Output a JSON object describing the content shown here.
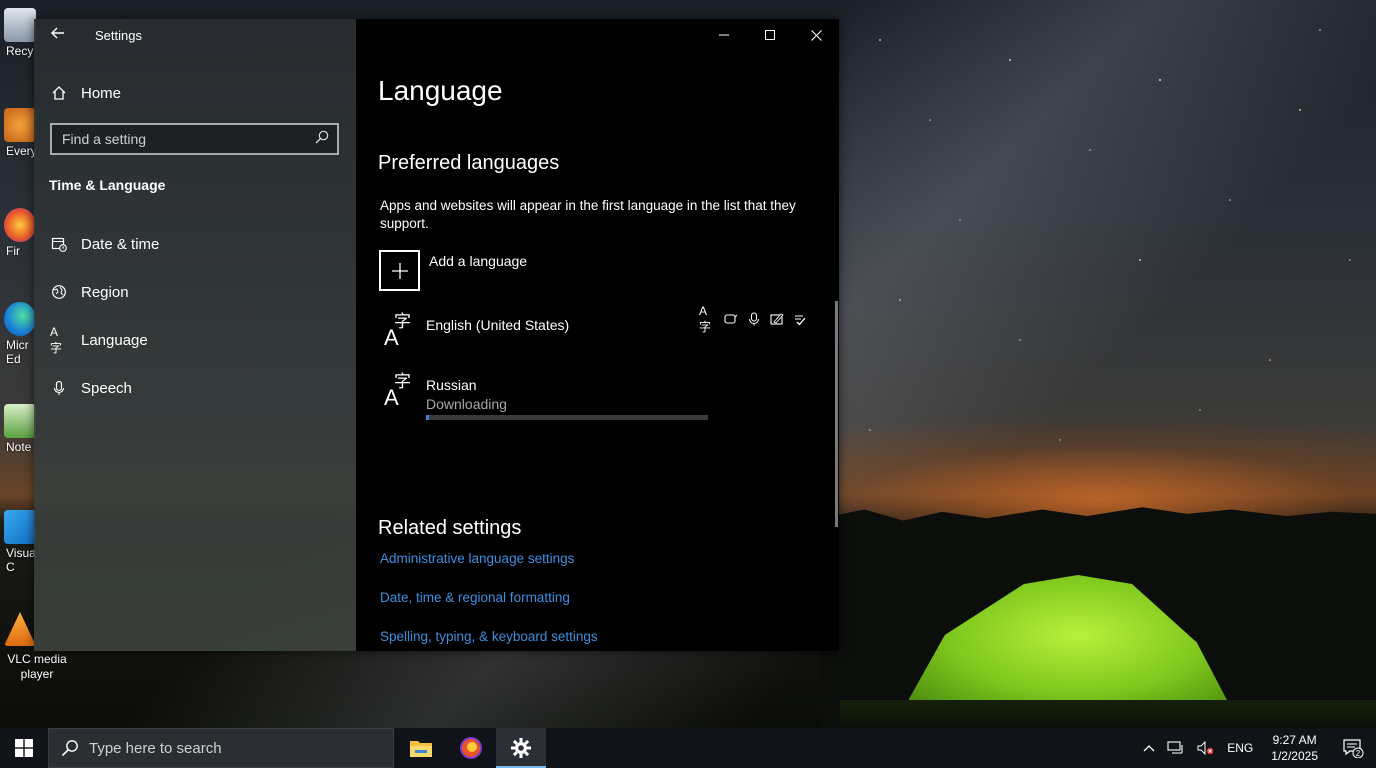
{
  "desktop": {
    "icons": [
      {
        "label": "Recy"
      },
      {
        "label": "Every"
      },
      {
        "label": "Fir"
      },
      {
        "label": "Micr Ed"
      },
      {
        "label": "Note"
      },
      {
        "label": "Visua C"
      }
    ],
    "vlc_label": "VLC media player"
  },
  "window": {
    "title": "Settings",
    "sidebar": {
      "home_label": "Home",
      "search_placeholder": "Find a setting",
      "section_title": "Time & Language",
      "items": [
        {
          "label": "Date & time",
          "icon": "calendar-clock-icon"
        },
        {
          "label": "Region",
          "icon": "globe-icon"
        },
        {
          "label": "Language",
          "icon": "language-icon"
        },
        {
          "label": "Speech",
          "icon": "microphone-icon"
        }
      ]
    },
    "content": {
      "page_title": "Language",
      "preferred_heading": "Preferred languages",
      "preferred_desc": "Apps and websites will appear in the first language in the list that they support.",
      "add_language_label": "Add a language",
      "languages": [
        {
          "name": "English (United States)",
          "status": ""
        },
        {
          "name": "Russian",
          "status": "Downloading",
          "progress_fraction": 0.01
        }
      ],
      "related_heading": "Related settings",
      "links": [
        "Administrative language settings",
        "Date, time & regional formatting",
        "Spelling, typing, & keyboard settings"
      ]
    }
  },
  "taskbar": {
    "search_placeholder": "Type here to search",
    "tray_lang": "ENG",
    "time": "9:27 AM",
    "date": "1/2/2025",
    "notification_count": "2"
  },
  "colors": {
    "link": "#3d8fe0",
    "progress": "#3d82d4",
    "taskbar": "#101418"
  }
}
